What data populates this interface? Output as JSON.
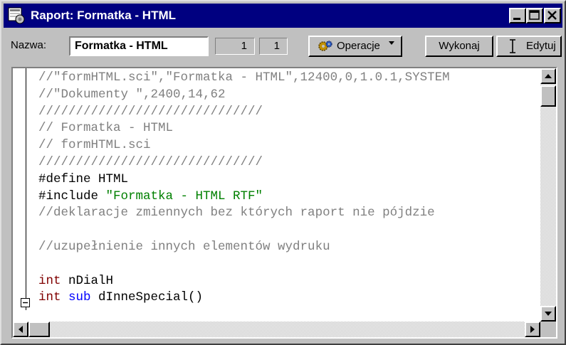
{
  "window": {
    "title": "Raport: Formatka - HTML",
    "title_bar_color": "#000080",
    "icons": [
      "app-icon",
      "minimize-icon",
      "maximize-icon",
      "close-icon"
    ]
  },
  "toolbar": {
    "name_label": "Nazwa:",
    "name_value": "Formatka - HTML",
    "num1": "1",
    "num2": "1",
    "operacje_label": "Operacje",
    "wykonaj_label": "Wykonaj",
    "edytuj_label": "Edytuj"
  },
  "code_lines": [
    {
      "text": "//\"formHTML.sci\",\"Formatka - HTML\",12400,0,1.0.1,SYSTEM",
      "kind": "comment"
    },
    {
      "text": "//\"Dokumenty \",2400,14,62",
      "kind": "comment"
    },
    {
      "text": "//////////////////////////////",
      "kind": "comment"
    },
    {
      "text": "// Formatka - HTML",
      "kind": "comment"
    },
    {
      "text": "// formHTML.sci",
      "kind": "comment"
    },
    {
      "text": "//////////////////////////////",
      "kind": "comment"
    },
    {
      "text": "#define HTML",
      "kind": "default"
    },
    {
      "parts": [
        {
          "text": "#include ",
          "kind": "default"
        },
        {
          "text": "\"Formatka - HTML RTF\"",
          "kind": "string"
        }
      ]
    },
    {
      "text": "//deklaracje zmiennych bez których raport nie pójdzie",
      "kind": "comment"
    },
    {
      "text": "",
      "kind": "default"
    },
    {
      "text": "//uzupełnienie innych elementów wydruku",
      "kind": "comment"
    },
    {
      "text": "",
      "kind": "default"
    },
    {
      "parts": [
        {
          "text": "int",
          "kind": "keyword"
        },
        {
          "text": " nDialH",
          "kind": "default"
        }
      ]
    },
    {
      "parts": [
        {
          "text": "int",
          "kind": "keyword"
        },
        {
          "text": " sub",
          "kind": "sub"
        },
        {
          "text": " dInneSpecial()",
          "kind": "default"
        }
      ]
    }
  ]
}
